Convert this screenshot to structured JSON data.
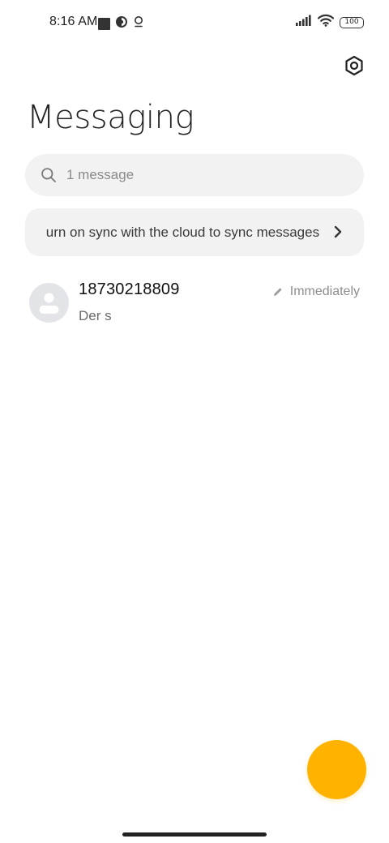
{
  "status_bar": {
    "time": "8:16 AM",
    "battery": "100",
    "icons": [
      "square-notification-icon",
      "circle-app-icon",
      "location-icon",
      "signal-icon",
      "wifi-icon",
      "battery-icon"
    ]
  },
  "header": {
    "title": "Messaging",
    "settings_icon": "settings-icon"
  },
  "search": {
    "placeholder": "1 message",
    "icon": "search-icon"
  },
  "sync_banner": {
    "text": "Turn on sync with the cloud to sync messages",
    "icon": "chevron-right-icon"
  },
  "conversations": [
    {
      "name": "18730218809",
      "preview": "Der s",
      "time": "Immediately",
      "status_icon": "draft-pencil-icon"
    }
  ],
  "fab": {
    "color": "#ffb300"
  },
  "colors": {
    "accent": "#ffb300",
    "surface": "#f2f2f2"
  }
}
